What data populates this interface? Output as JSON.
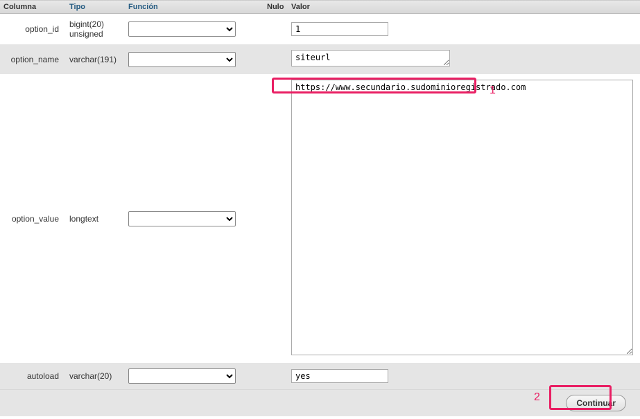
{
  "headers": {
    "columna": "Columna",
    "tipo": "Tipo",
    "funcion": "Función",
    "nulo": "Nulo",
    "valor": "Valor"
  },
  "rows": [
    {
      "columna": "option_id",
      "tipo": "bigint(20) unsigned",
      "funcion": "",
      "valor": "1"
    },
    {
      "columna": "option_name",
      "tipo": "varchar(191)",
      "funcion": "",
      "valor": "siteurl"
    },
    {
      "columna": "option_value",
      "tipo": "longtext",
      "funcion": "",
      "valor": "https://www.secundario.sudominioregistrado.com"
    },
    {
      "columna": "autoload",
      "tipo": "varchar(20)",
      "funcion": "",
      "valor": "yes"
    }
  ],
  "annotations": {
    "one": "1",
    "two": "2"
  },
  "footer": {
    "continuar": "Continuar"
  }
}
